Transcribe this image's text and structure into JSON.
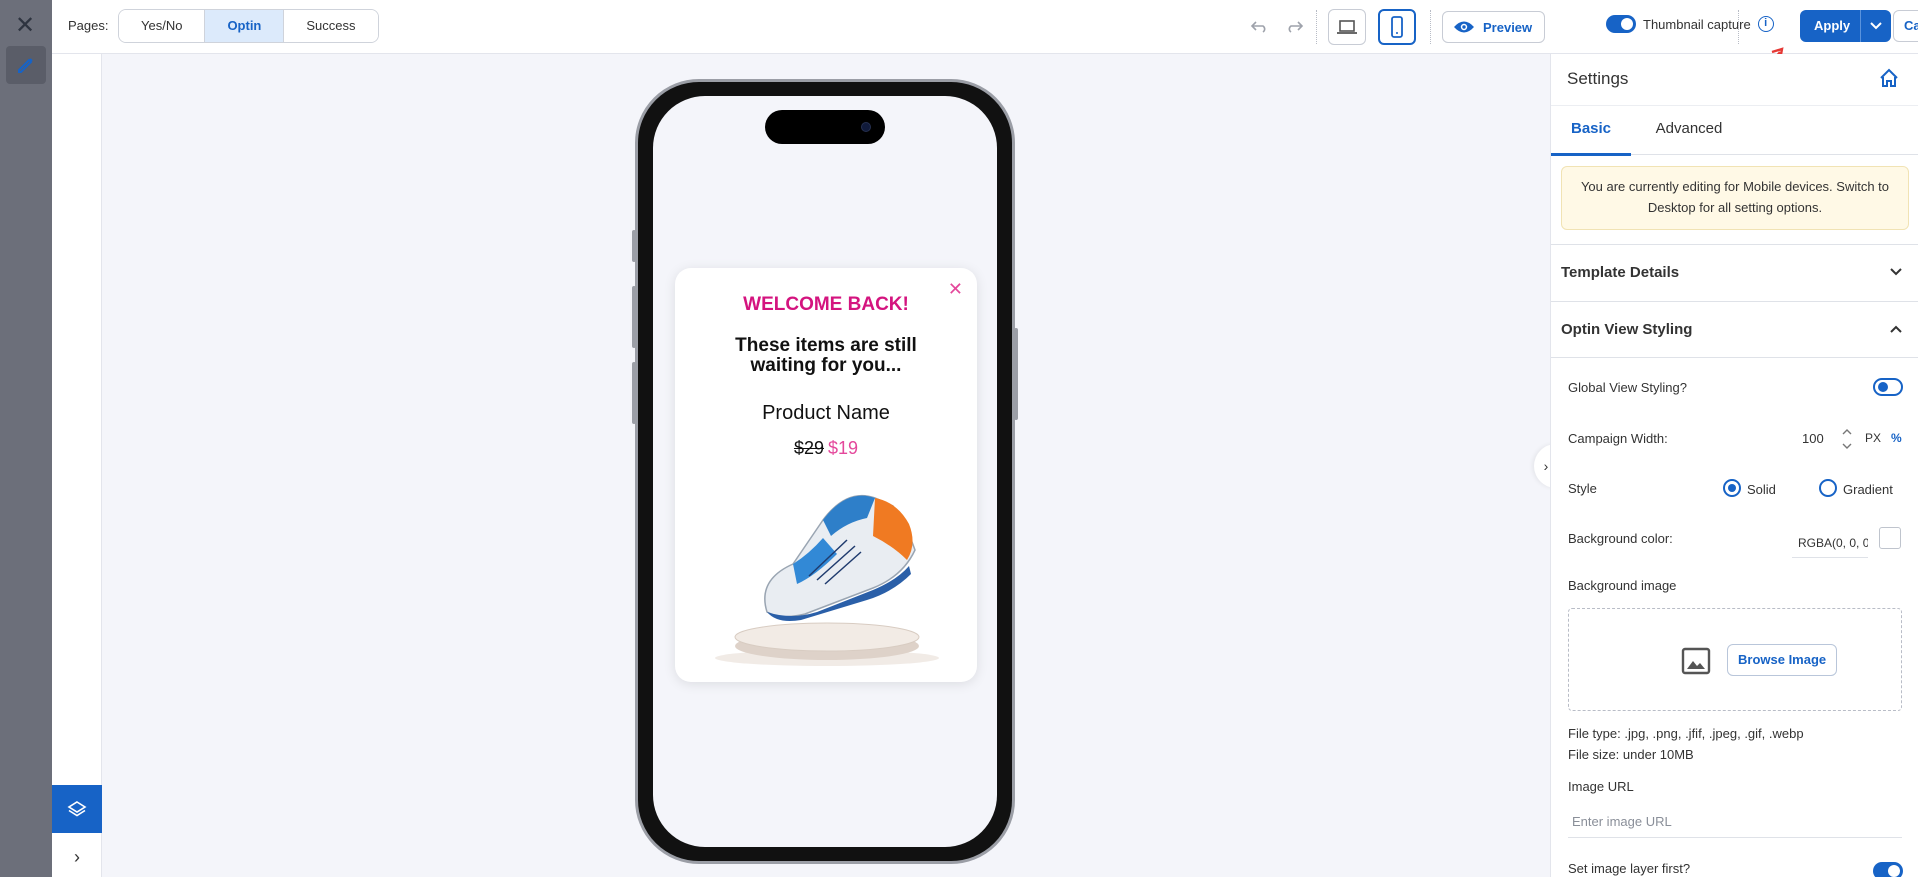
{
  "topbar": {
    "pages_label": "Pages:",
    "pages": [
      {
        "label": "Yes/No",
        "active": false
      },
      {
        "label": "Optin",
        "active": true
      },
      {
        "label": "Success",
        "active": false
      }
    ],
    "preview_label": "Preview",
    "thumbnail_label": "Thumbnail capture",
    "thumbnail_enabled": true,
    "apply_label": "Apply",
    "cancel_label": "Cancel",
    "active_device": "mobile"
  },
  "popup": {
    "welcome": "WELCOME BACK!",
    "title": "These items are still waiting for you...",
    "product_name": "Product Name",
    "old_price": "$29",
    "new_price": "$19"
  },
  "panel": {
    "title": "Settings",
    "tabs": [
      {
        "label": "Basic",
        "active": true
      },
      {
        "label": "Advanced",
        "active": false
      }
    ],
    "notice": "You are currently editing for Mobile devices. Switch to Desktop for all setting options.",
    "template_details": "Template Details",
    "optin_view_styling": "Optin View Styling",
    "global_view_label": "Global View Styling?",
    "global_view_enabled": false,
    "campaign_width_label": "Campaign Width:",
    "campaign_width_value": "100",
    "unit_px": "PX",
    "unit_pct": "%",
    "style_label": "Style",
    "style_options": [
      {
        "label": "Solid",
        "checked": true
      },
      {
        "label": "Gradient",
        "checked": false
      }
    ],
    "bg_color_label": "Background color:",
    "bg_color_value": "RGBA(0, 0, 0",
    "bg_image_label": "Background image",
    "browse_label": "Browse Image",
    "file_types": "File type: .jpg, .png, .jfif, .jpeg, .gif, .webp",
    "file_size": "File size: under 10MB",
    "image_url_label": "Image URL",
    "image_url_placeholder": "Enter image URL",
    "image_layer_label": "Set image layer first?",
    "image_layer_enabled": true
  },
  "colors": {
    "accent": "#1763c6",
    "welcome_pink": "#d4147f",
    "price_pink": "#e4479b",
    "notice_bg": "#fff9e6"
  },
  "icons": [
    "close-icon",
    "pencil-icon",
    "layers-icon",
    "chevron-right-icon",
    "undo-icon",
    "redo-icon",
    "laptop-icon",
    "mobile-icon",
    "eye-icon",
    "info-icon",
    "chevron-down-icon",
    "home-icon",
    "image-icon"
  ]
}
